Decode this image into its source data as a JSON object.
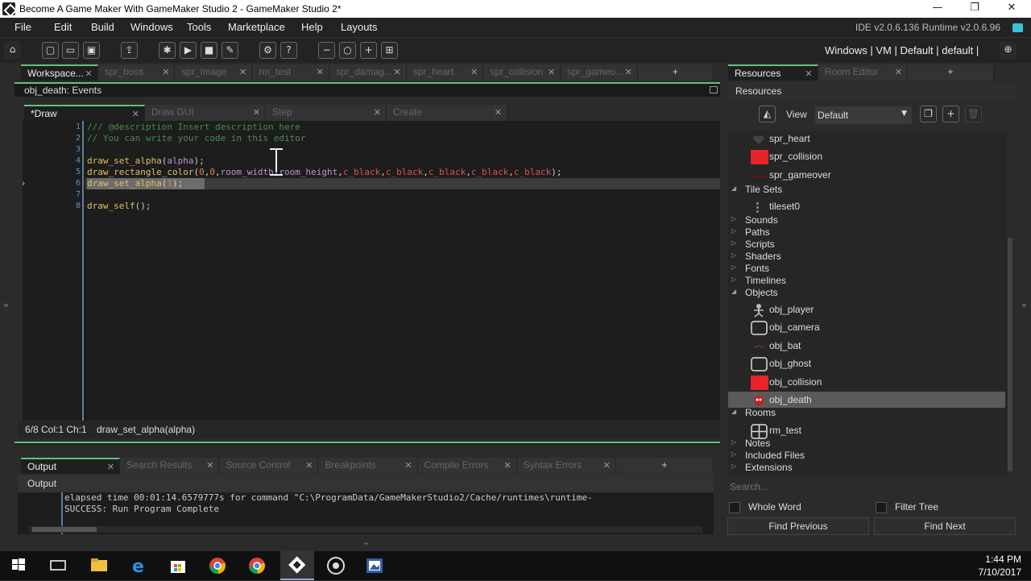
{
  "window": {
    "title": "Become A Game Maker With GameMaker Studio 2 - GameMaker Studio 2*",
    "min": "—",
    "max": "❐",
    "close": "✕"
  },
  "menu": {
    "items": [
      "File",
      "Edit",
      "Build",
      "Windows",
      "Tools",
      "Marketplace",
      "Help",
      "Layouts"
    ],
    "version": "IDE v2.0.6.136 Runtime v2.0.6.96"
  },
  "toolbar": {
    "target": "Windows | VM | Default | default |"
  },
  "workspace_tabs": [
    {
      "label": "Workspace...",
      "x": "✕"
    },
    {
      "label": "spr_boss",
      "x": "✕"
    },
    {
      "label": "spr_image",
      "x": "✕"
    },
    {
      "label": "rm_test",
      "x": "✕"
    },
    {
      "label": "spr_damag...",
      "x": "✕"
    },
    {
      "label": "spr_heart",
      "x": "✕"
    },
    {
      "label": "spr_collision",
      "x": "✕"
    },
    {
      "label": "spr_gameo...",
      "x": "✕"
    }
  ],
  "add_tab": "+",
  "object_header": "obj_death: Events",
  "event_tabs": [
    {
      "label": "*Draw",
      "x": "✕"
    },
    {
      "label": "Draw GUI",
      "x": "✕"
    },
    {
      "label": "Step",
      "x": "✕"
    },
    {
      "label": "Create",
      "x": "✕"
    }
  ],
  "code": {
    "line_numbers": [
      "1",
      "2",
      "3",
      "4",
      "5",
      "6",
      "7",
      "8"
    ],
    "line1": "/// @description Insert description here",
    "line2": "// You can write your code in this editor",
    "line4_fn": "draw_set_alpha",
    "line4_open": "(",
    "line4_arg": "alpha",
    "line4_close": ");",
    "line5_fn": "draw_rectangle_color",
    "line5_open": "(",
    "line5_n0": "0",
    "line5_c1": ",",
    "line5_n1": "0",
    "line5_c2": ",",
    "line5_v1": "room_width",
    "line5_c3": ",",
    "line5_v2": "room_height",
    "line5_c4": ",",
    "line5_k1": "c_black",
    "line5_c5": ",",
    "line5_k2": "c_black",
    "line5_c6": ",",
    "line5_k3": "c_black",
    "line5_c7": ",",
    "line5_k4": "c_black",
    "line5_c8": ",",
    "line5_k5": "c_black",
    "line5_close": ");",
    "line6_fn": "draw_set_alpha",
    "line6_open": "(",
    "line6_n": "1",
    "line6_close": ");",
    "line8_fn": "draw_self",
    "line8_rest": "();"
  },
  "status": {
    "position": "6/8 Col:1 Ch:1",
    "hint": "draw_set_alpha(alpha)"
  },
  "output_tabs": [
    {
      "label": "Output",
      "x": "✕"
    },
    {
      "label": "Search Results",
      "x": "✕"
    },
    {
      "label": "Source Control",
      "x": "✕"
    },
    {
      "label": "Breakpoints",
      "x": "✕"
    },
    {
      "label": "Compile Errors",
      "x": "✕"
    },
    {
      "label": "Syntax Errors",
      "x": "✕"
    }
  ],
  "output": {
    "header": "Output",
    "line1": "elapsed time 00:01:14.6579777s for command \"C:\\ProgramData/GameMakerStudio2/Cache/runtimes\\runtime-",
    "line2": "SUCCESS: Run Program Complete"
  },
  "resources": {
    "tabs": [
      {
        "label": "Resources",
        "x": "✕"
      },
      {
        "label": "Room Editor",
        "x": "✕"
      }
    ],
    "title": "Resources",
    "view_label": "View",
    "view_value": "Default",
    "tree": [
      {
        "label": "spr_heart",
        "kind": "heart-sprite"
      },
      {
        "label": "spr_collision",
        "kind": "red-block"
      },
      {
        "label": "spr_gameover",
        "kind": "red-line"
      },
      {
        "label": "Tile Sets",
        "kind": "group-open"
      },
      {
        "label": "tileset0",
        "kind": "tileset"
      },
      {
        "label": "Sounds",
        "kind": "group"
      },
      {
        "label": "Paths",
        "kind": "group"
      },
      {
        "label": "Scripts",
        "kind": "group"
      },
      {
        "label": "Shaders",
        "kind": "group"
      },
      {
        "label": "Fonts",
        "kind": "group"
      },
      {
        "label": "Timelines",
        "kind": "group"
      },
      {
        "label": "Objects",
        "kind": "group-open"
      },
      {
        "label": "obj_player",
        "kind": "player"
      },
      {
        "label": "obj_camera",
        "kind": "empty-object"
      },
      {
        "label": "obj_bat",
        "kind": "bat"
      },
      {
        "label": "obj_ghost",
        "kind": "empty-object"
      },
      {
        "label": "obj_collision",
        "kind": "red-block"
      },
      {
        "label": "obj_death",
        "kind": "death",
        "selected": true
      },
      {
        "label": "Rooms",
        "kind": "group-open"
      },
      {
        "label": "rm_test",
        "kind": "room"
      },
      {
        "label": "Notes",
        "kind": "group"
      },
      {
        "label": "Included Files",
        "kind": "group"
      },
      {
        "label": "Extensions",
        "kind": "group"
      }
    ],
    "search_placeholder": "Search...",
    "whole_word": "Whole Word",
    "filter_tree": "Filter Tree",
    "find_prev": "Find Previous",
    "find_next": "Find Next"
  },
  "taskbar": {
    "time": "1:44 PM",
    "date": "7/10/2017"
  },
  "colors": {
    "accent": "#64c07a",
    "selection": "#5a5a5a",
    "red": "#e8232a"
  }
}
